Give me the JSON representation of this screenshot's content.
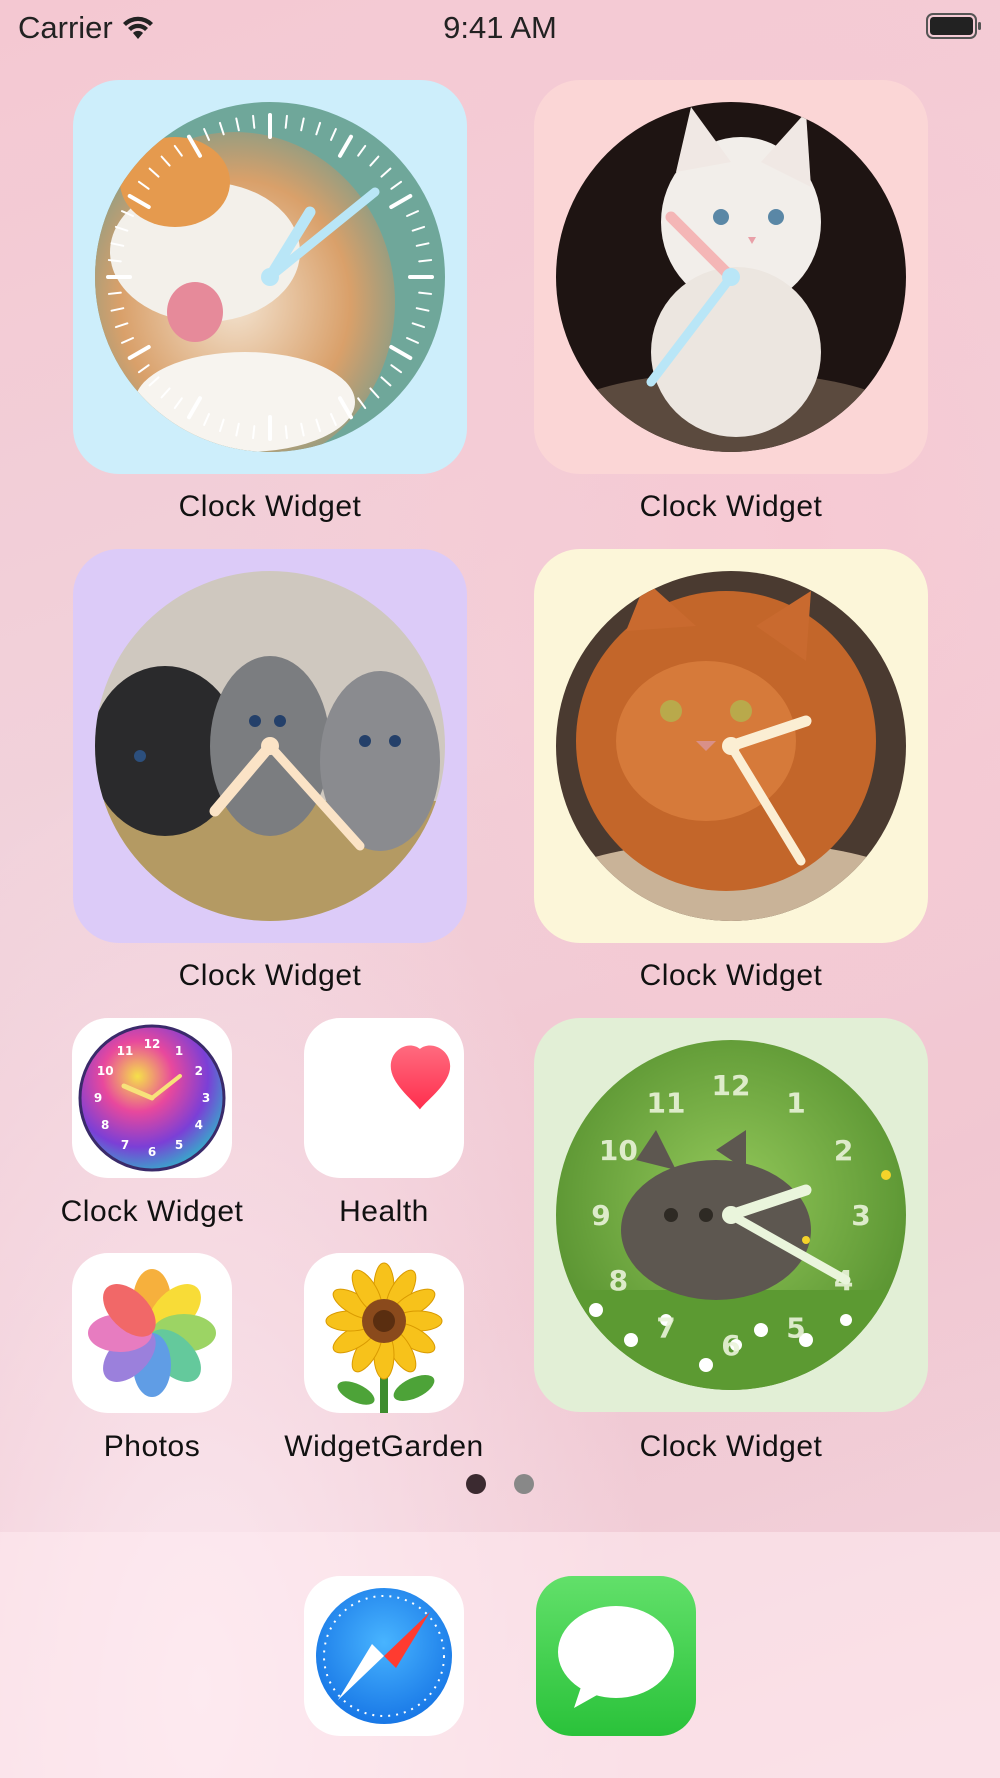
{
  "status_bar": {
    "carrier": "Carrier",
    "time": "9:41 AM"
  },
  "widgets": [
    {
      "label": "Clock Widget",
      "frame_color": "#cdeefb"
    },
    {
      "label": "Clock Widget",
      "frame_color": "#fbd6d6"
    },
    {
      "label": "Clock Widget",
      "frame_color": "#dccbf8"
    },
    {
      "label": "Clock Widget",
      "frame_color": "#fcf6d9"
    },
    {
      "label": "Clock Widget",
      "frame_color": "#e2efd6"
    }
  ],
  "apps": [
    {
      "label": "Clock Widget",
      "icon": "colorful-clock-icon"
    },
    {
      "label": "Health",
      "icon": "heart-icon"
    },
    {
      "label": "Photos",
      "icon": "photos-flower-icon"
    },
    {
      "label": "WidgetGarden",
      "icon": "sunflower-icon"
    }
  ],
  "green_clock_numerals": [
    "12",
    "1",
    "2",
    "3",
    "4",
    "5",
    "6",
    "7",
    "8",
    "9",
    "10",
    "11"
  ],
  "small_clock_numerals": [
    "12",
    "1",
    "2",
    "3",
    "4",
    "5",
    "6",
    "7",
    "8",
    "9",
    "10",
    "11"
  ],
  "page_dots": {
    "count": 2,
    "active": 1
  },
  "dock": [
    {
      "name": "Safari",
      "icon": "safari-compass-icon"
    },
    {
      "name": "Messages",
      "icon": "messages-bubble-icon"
    }
  ]
}
